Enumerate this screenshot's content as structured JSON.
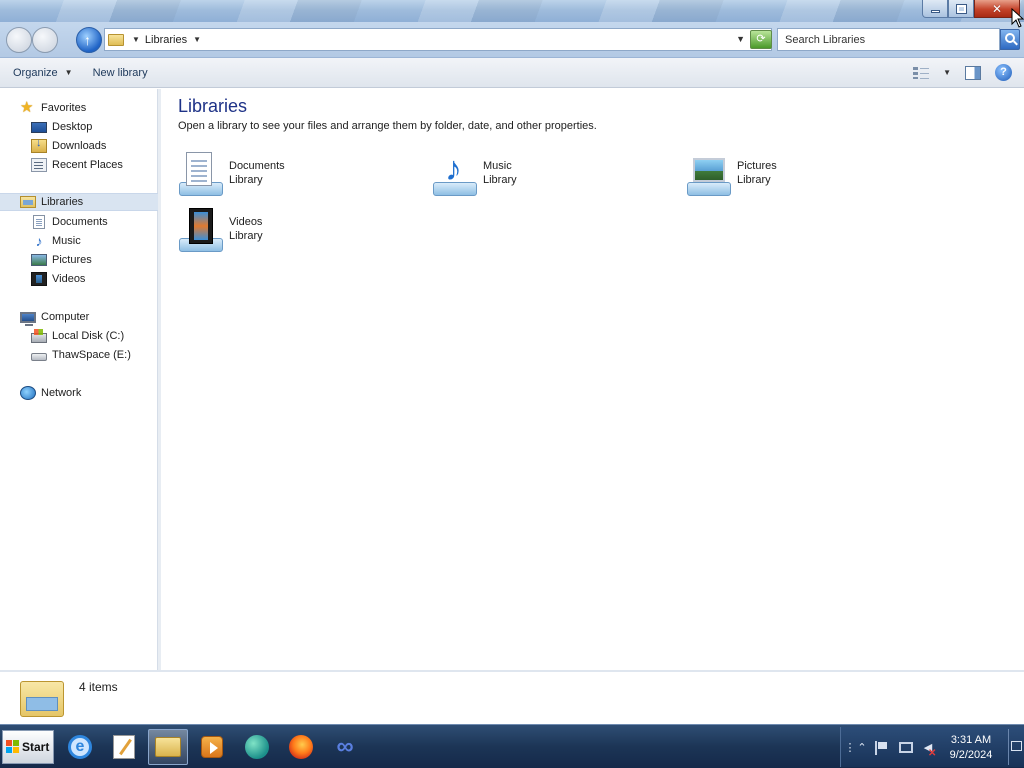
{
  "window": {
    "caption_buttons": {
      "minimize": "minimize",
      "maximize": "restore",
      "close": "✕"
    }
  },
  "address": {
    "path_segments": [
      "Libraries"
    ],
    "refresh_icon": "refresh-icon",
    "up_icon": "up-arrow-icon"
  },
  "search": {
    "placeholder": "Search Libraries",
    "icon": "search-icon"
  },
  "commands": {
    "organize_label": "Organize",
    "new_library_label": "New library",
    "help_glyph": "?"
  },
  "nav": {
    "favorites": {
      "label": "Favorites",
      "items": [
        {
          "label": "Desktop",
          "icon": "desktop-icon"
        },
        {
          "label": "Downloads",
          "icon": "downloads-icon"
        },
        {
          "label": "Recent Places",
          "icon": "recent-places-icon"
        }
      ]
    },
    "libraries": {
      "label": "Libraries",
      "items": [
        {
          "label": "Documents",
          "icon": "documents-icon"
        },
        {
          "label": "Music",
          "icon": "music-icon"
        },
        {
          "label": "Pictures",
          "icon": "pictures-icon"
        },
        {
          "label": "Videos",
          "icon": "videos-icon"
        }
      ]
    },
    "computer": {
      "label": "Computer",
      "items": [
        {
          "label": "Local Disk (C:)",
          "icon": "local-disk-icon"
        },
        {
          "label": "ThawSpace (E:)",
          "icon": "removable-drive-icon"
        }
      ]
    },
    "network": {
      "label": "Network",
      "icon": "network-icon"
    }
  },
  "content": {
    "title": "Libraries",
    "description": "Open a library to see your files and arrange them by folder, date, and other properties.",
    "libraries": [
      {
        "name": "Documents",
        "type": "Library",
        "icon": "documents-library-icon"
      },
      {
        "name": "Music",
        "type": "Library",
        "icon": "music-library-icon"
      },
      {
        "name": "Pictures",
        "type": "Library",
        "icon": "pictures-library-icon"
      },
      {
        "name": "Videos",
        "type": "Library",
        "icon": "videos-library-icon"
      }
    ]
  },
  "details": {
    "item_count": "4 items"
  },
  "taskbar": {
    "start_label": "Start",
    "apps": [
      "internet-explorer-icon",
      "notepad-icon",
      "windows-explorer-icon",
      "media-player-icon",
      "browser-icon",
      "firefox-icon",
      "infinity-app-icon"
    ],
    "clock": {
      "time": "3:31 AM",
      "date": "9/2/2024"
    }
  }
}
